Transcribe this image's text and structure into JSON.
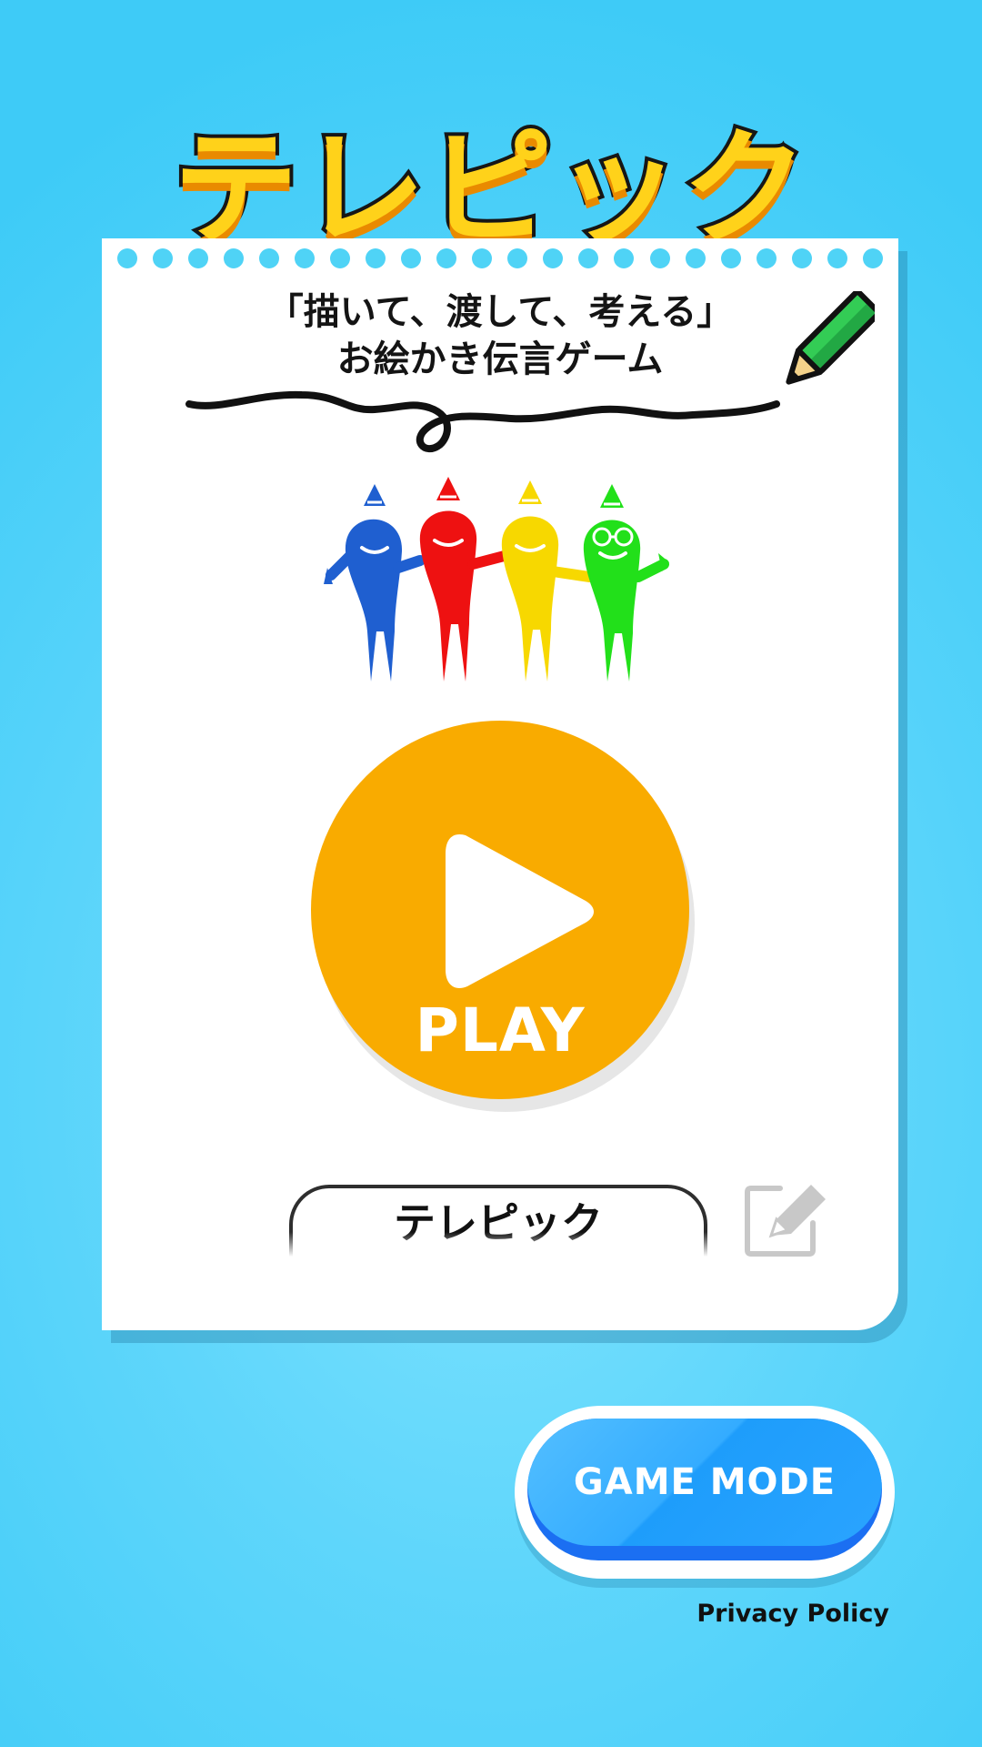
{
  "logo": {
    "title": "テレピック"
  },
  "card": {
    "tagline_line1": "「描いて、渡して、考える」",
    "tagline_line2": "お絵かき伝言ゲーム",
    "characters": [
      "blue",
      "red",
      "yellow",
      "green"
    ],
    "play_label": "PLAY",
    "player_name": "テレピック"
  },
  "game_mode": {
    "label": "GAME MODE"
  },
  "footer": {
    "privacy_label": "Privacy Policy"
  },
  "colors": {
    "background": "#4fd3f6",
    "play_button": "#f9ab00",
    "game_mode_button": "#2aa4ff",
    "logo_fill": "#ffd21a",
    "character_blue": "#1f5fd0",
    "character_red": "#ee1111",
    "character_yellow": "#f7d800",
    "character_green": "#22e01a"
  },
  "icons": {
    "play": "play-triangle-icon",
    "edit": "edit-pencil-icon",
    "pencil": "green-pencil-icon"
  }
}
